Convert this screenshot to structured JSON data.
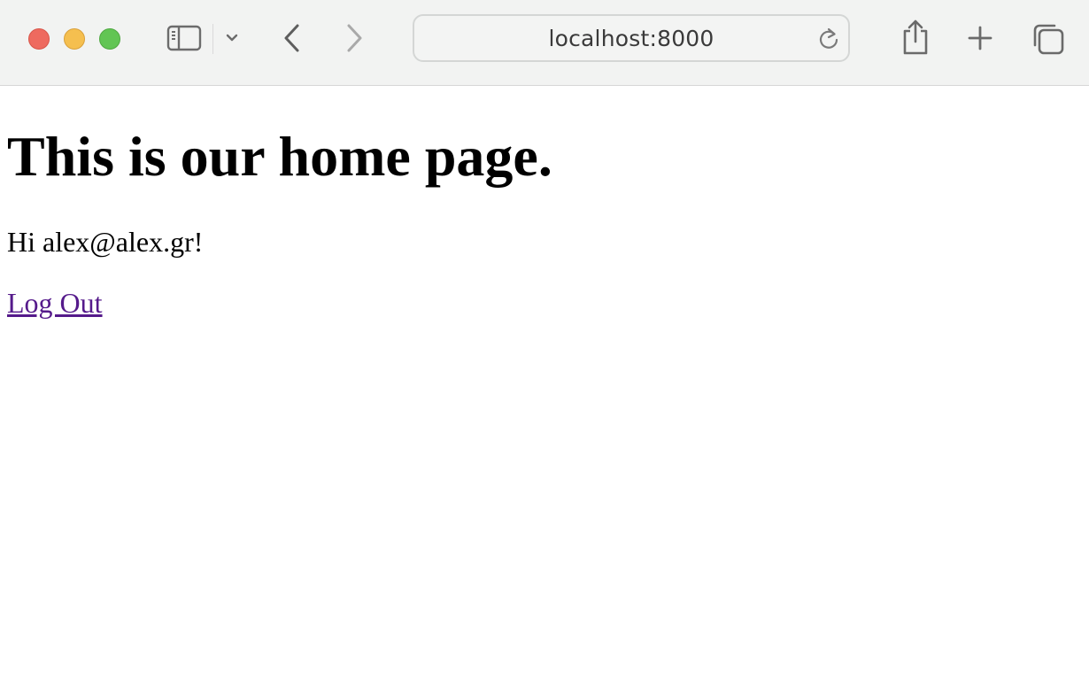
{
  "browser": {
    "address_bar": {
      "url": "localhost:8000"
    },
    "icons": {
      "traffic_close": "close-dot",
      "traffic_minimize": "minimize-dot",
      "traffic_zoom": "zoom-dot",
      "sidebar": "sidebar-icon",
      "tab_group_menu": "chevron-down-icon",
      "back": "chevron-left-icon",
      "forward": "chevron-right-icon",
      "reload": "reload-icon",
      "share": "share-icon",
      "new_tab": "plus-icon",
      "tab_overview": "tabs-overview-icon"
    },
    "colors": {
      "close": "#ee6a5f",
      "minimize": "#f5bf4f",
      "zoom": "#62c554",
      "toolbar_bg": "#f2f3f2"
    }
  },
  "page": {
    "heading": "This is our home page.",
    "greeting": "Hi alex@alex.gr!",
    "logout_label": "Log Out",
    "colors": {
      "text": "#000000",
      "visited_link": "#551a8b"
    }
  }
}
